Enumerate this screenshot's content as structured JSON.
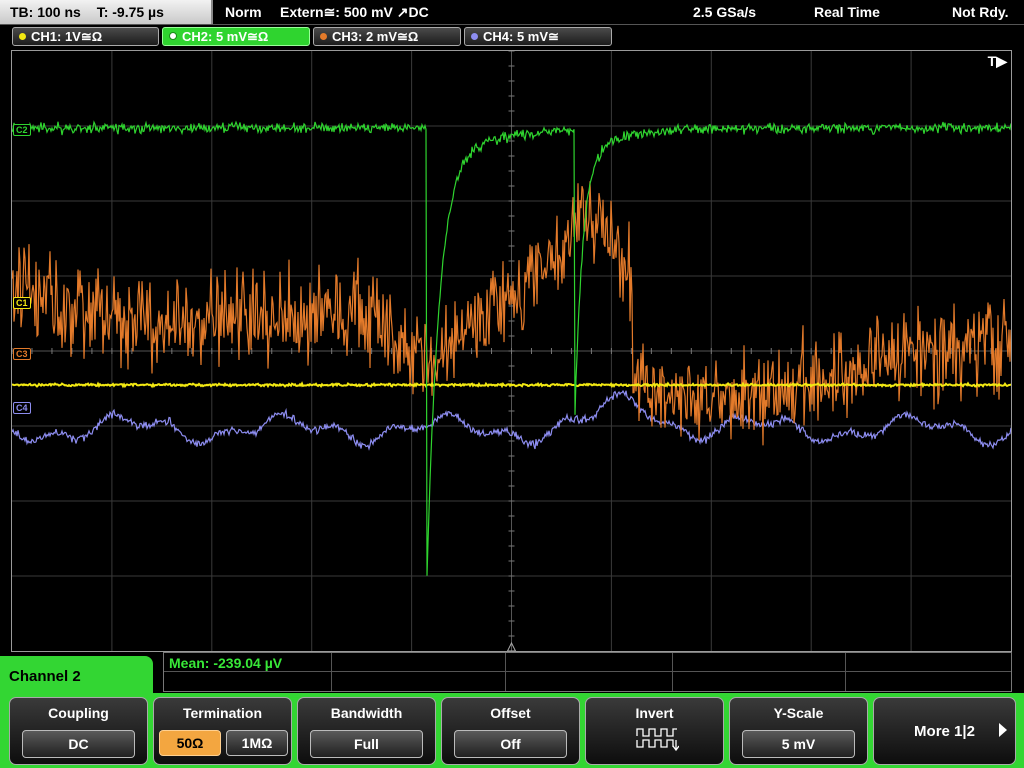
{
  "status": {
    "timebase": "TB: 100 ns",
    "trigger_time": "T: -9.75 µs",
    "trigger_mode": "Norm",
    "trigger_source": "Extern≅: 500 mV ↗DC",
    "sample_rate": "2.5 GSa/s",
    "acq_mode": "Real Time",
    "run_state": "Not Rdy."
  },
  "channels": [
    {
      "id": "ch1",
      "label": "CH1: 1V≅Ω",
      "color": "#f2e812",
      "marker": "C1"
    },
    {
      "id": "ch2",
      "label": "CH2: 5 mV≅Ω",
      "color": "#2fd42f",
      "marker": "C2"
    },
    {
      "id": "ch3",
      "label": "CH3: 2 mV≅Ω",
      "color": "#e37a2a",
      "marker": "C3"
    },
    {
      "id": "ch4",
      "label": "CH4: 5 mV≅",
      "color": "#8d8df0",
      "marker": "C4"
    }
  ],
  "trigger_marker": "T▶",
  "measurement": {
    "value": "Mean: -239.04 µV"
  },
  "menu": {
    "title": "Channel 2",
    "coupling": {
      "label": "Coupling",
      "value": "DC"
    },
    "termination": {
      "label": "Termination",
      "options": [
        "50Ω",
        "1MΩ"
      ],
      "selected": "50Ω"
    },
    "bandwidth": {
      "label": "Bandwidth",
      "value": "Full"
    },
    "offset": {
      "label": "Offset",
      "value": "Off"
    },
    "invert": {
      "label": "Invert",
      "icon": "invert-waveform-icon"
    },
    "yscale": {
      "label": "Y-Scale",
      "value": "5 mV"
    },
    "more": {
      "label": "More 1|2"
    }
  }
}
